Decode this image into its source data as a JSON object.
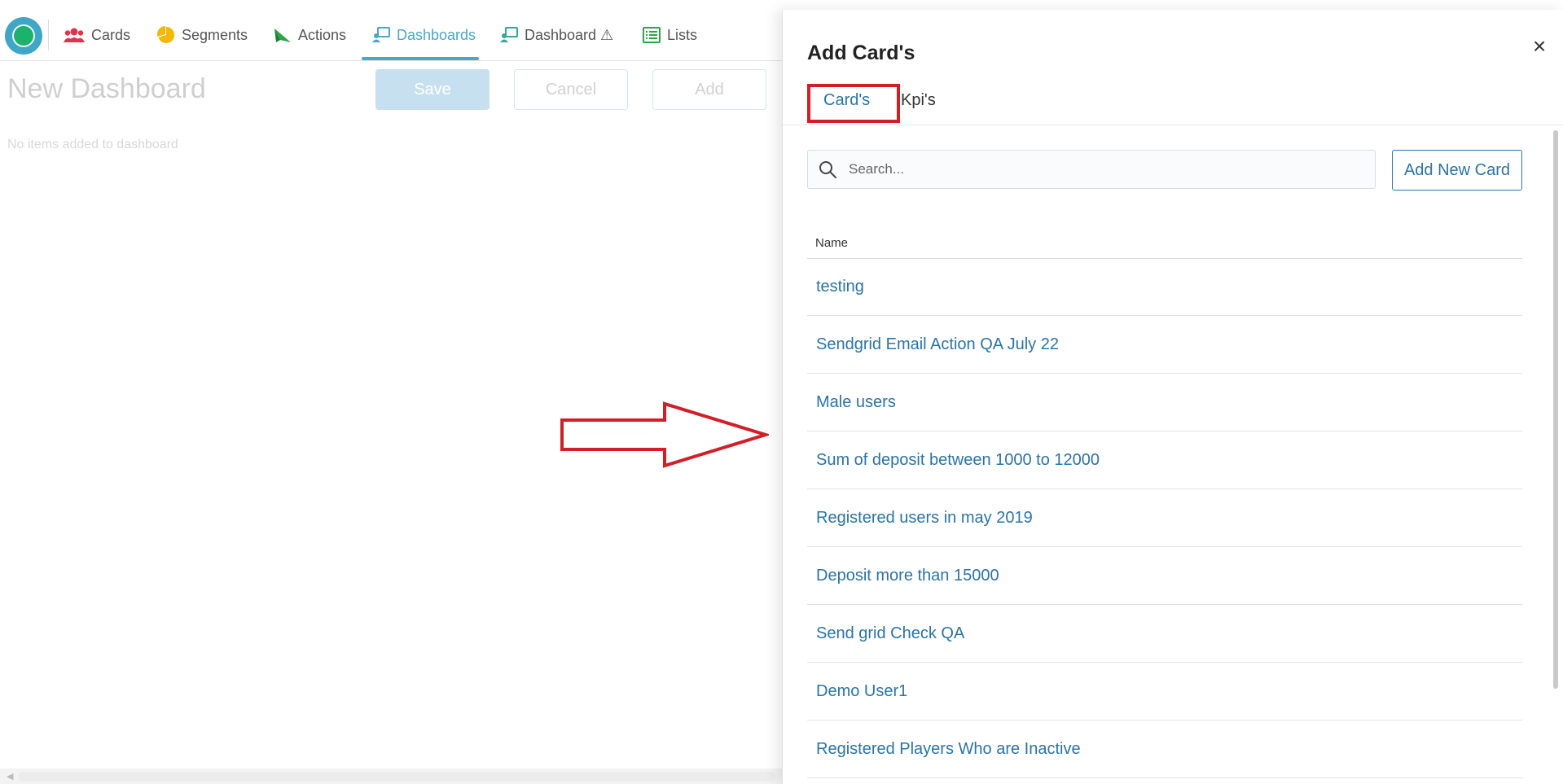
{
  "nav": {
    "items": [
      {
        "label": "Cards",
        "icon": "users-icon",
        "color": "#e0344a"
      },
      {
        "label": "Segments",
        "icon": "pie-chart-icon",
        "color": "#f5b800"
      },
      {
        "label": "Actions",
        "icon": "paper-plane-icon",
        "color": "#28a745"
      },
      {
        "label": "Dashboards",
        "icon": "dashboard-icon",
        "color": "#4ba6c7"
      },
      {
        "label": "Dashboard ⚠",
        "icon": "dashboard-icon",
        "color": "#2fa9a0"
      },
      {
        "label": "Lists",
        "icon": "list-icon",
        "color": "#28a745"
      }
    ],
    "active": "Dashboards"
  },
  "dashboard": {
    "title": "New Dashboard",
    "save_label": "Save",
    "cancel_label": "Cancel",
    "add_label": "Add",
    "empty_message": "No items added to dashboard"
  },
  "panel": {
    "title": "Add Card's",
    "close_symbol": "×",
    "tabs": [
      "Card's",
      "Kpi's"
    ],
    "active_tab": "Card's",
    "search_placeholder": "Search...",
    "add_new_label": "Add New Card",
    "column_name": "Name",
    "rows": [
      "testing",
      "Sendgrid Email Action QA July 22",
      "Male users",
      "Sum of deposit between 1000 to 12000",
      "Registered users in may 2019",
      "Deposit more than 15000",
      "Send grid Check QA",
      "Demo User1",
      "Registered Players Who are Inactive"
    ]
  },
  "colors": {
    "accent": "#4ba6c7",
    "link": "#2a74a8",
    "annotation_red": "#d11f2a"
  }
}
